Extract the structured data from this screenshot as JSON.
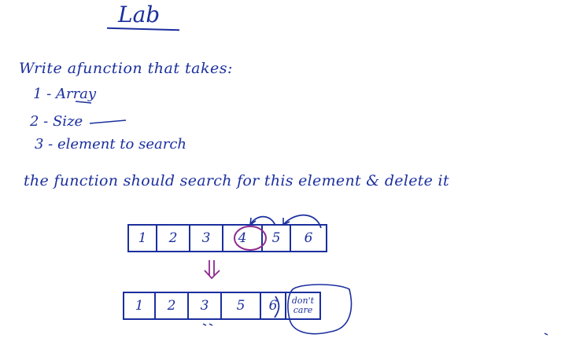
{
  "title": "Lab",
  "instruction": "Write afunction that takes:",
  "params": [
    "1 - Array",
    "2 - Size",
    "3 - element to search"
  ],
  "requirement": "the function should search for this element & delete it",
  "array_before": [
    "1",
    "2",
    "3",
    "4",
    "5",
    "6"
  ],
  "array_after": [
    "1",
    "2",
    "3",
    "5",
    "6",
    "don't care"
  ],
  "colors": {
    "ink": "#1b2f9e",
    "highlight": "#8e2a8e"
  }
}
